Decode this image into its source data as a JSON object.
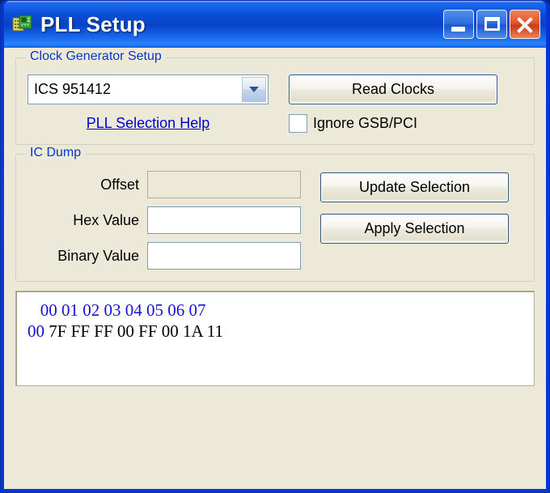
{
  "window": {
    "title": "PLL Setup",
    "icon": "ic-chip-icon",
    "caption_buttons": [
      {
        "name": "minimize-button",
        "glyph": "minimize"
      },
      {
        "name": "maximize-button",
        "glyph": "maximize"
      },
      {
        "name": "close-button",
        "glyph": "close"
      }
    ],
    "colors": {
      "titlebar": "#0a4fd6",
      "client_background": "#ece9d8",
      "group_label": "#0a36c8",
      "link": "#0000cc",
      "close_button": "#e4552a",
      "dump_header": "#1414d2"
    }
  },
  "clock_generator": {
    "group_title": "Clock Generator Setup",
    "pll_select": {
      "value": "ICS 951412",
      "arrow_icon": "chevron-down-icon"
    },
    "read_clocks_label": "Read Clocks",
    "help_link_label": "PLL Selection Help",
    "ignore_checkbox": {
      "label": "Ignore GSB/PCI",
      "checked": false
    }
  },
  "ic_dump": {
    "group_title": "IC Dump",
    "fields": [
      {
        "label": "Offset",
        "value": "",
        "placeholder": "",
        "disabled": true
      },
      {
        "label": "Hex Value",
        "value": "",
        "placeholder": "",
        "disabled": false
      },
      {
        "label": "Binary Value",
        "value": "",
        "placeholder": "",
        "disabled": false
      }
    ],
    "update_label": "Update Selection",
    "apply_label": "Apply Selection"
  },
  "dump_view": {
    "header_offset_pad": "   ",
    "header_columns": "00 01 02 03 04 05 06 07",
    "row_offset": "00",
    "row_values": "7F FF FF 00 FF 00 1A 11"
  }
}
